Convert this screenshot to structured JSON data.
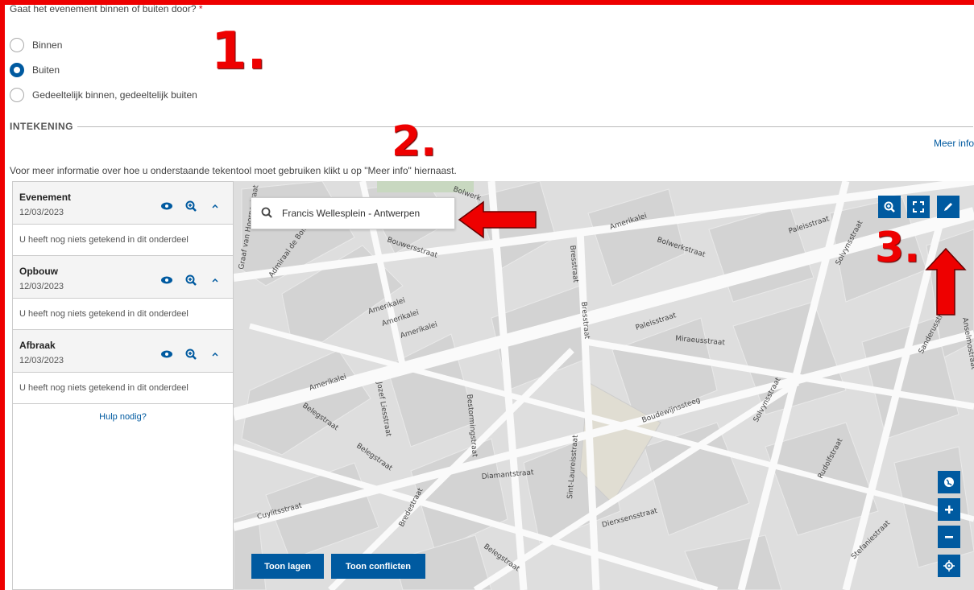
{
  "question": {
    "label": "Gaat het evenement binnen of buiten door?",
    "required_mark": "*"
  },
  "options": [
    {
      "label": "Binnen",
      "selected": false
    },
    {
      "label": "Buiten",
      "selected": true
    },
    {
      "label": "Gedeeltelijk binnen, gedeeltelijk buiten",
      "selected": false
    }
  ],
  "annotations": {
    "one": "1.",
    "two": "2.",
    "three": "3."
  },
  "section": {
    "title": "INTEKENING",
    "meer_info": "Meer info",
    "info_text": "Voor meer informatie over hoe u onderstaande tekentool moet gebruiken klikt u op \"Meer info\" hiernaast."
  },
  "groups": [
    {
      "title": "Evenement",
      "date": "12/03/2023",
      "empty_text": "U heeft nog niets getekend in dit onderdeel"
    },
    {
      "title": "Opbouw",
      "date": "12/03/2023",
      "empty_text": "U heeft nog niets getekend in dit onderdeel"
    },
    {
      "title": "Afbraak",
      "date": "12/03/2023",
      "empty_text": "U heeft nog niets getekend in dit onderdeel"
    }
  ],
  "help_link": "Hulp nodig?",
  "map": {
    "search_value": "Francis Wellesplein - Antwerpen",
    "buttons": {
      "toon_lagen": "Toon lagen",
      "toon_conflicten": "Toon conflicten"
    },
    "streets": [
      "Amerikalei",
      "Bolwerkstraat",
      "Paleisstraat",
      "Solvynsstraat",
      "Bresstraat",
      "Bresstraat",
      "Amerikalei",
      "Amerikalei",
      "Amerikalei",
      "Paleisstraat",
      "Miraeusstraat",
      "Sanderusstraat",
      "Anselmostraat",
      "Amerikalei",
      "Jozef Liesstraat",
      "Belegstraat",
      "Belegstraat",
      "Bestormingstraat",
      "Boudewijnssteeg",
      "Solvynsstraat",
      "Rudolfstraat",
      "Bredestraat",
      "Sint-Laureisstraat",
      "Diamantstraat",
      "Cuylitsstraat",
      "Dierxsensstraat",
      "Stefaniestraat",
      "Belegstraat",
      "Admiraal de Boisotstraat",
      "Graaf van Hoornestraat",
      "Bouwersstraat",
      "Bolwerk"
    ],
    "icons": [
      "zoom-in-icon",
      "fullscreen-icon",
      "edit-pencil-icon",
      "globe-icon",
      "plus-icon",
      "minus-icon",
      "locate-icon"
    ]
  },
  "colors": {
    "accent": "#005aa0",
    "annotation_red": "#e00000"
  }
}
